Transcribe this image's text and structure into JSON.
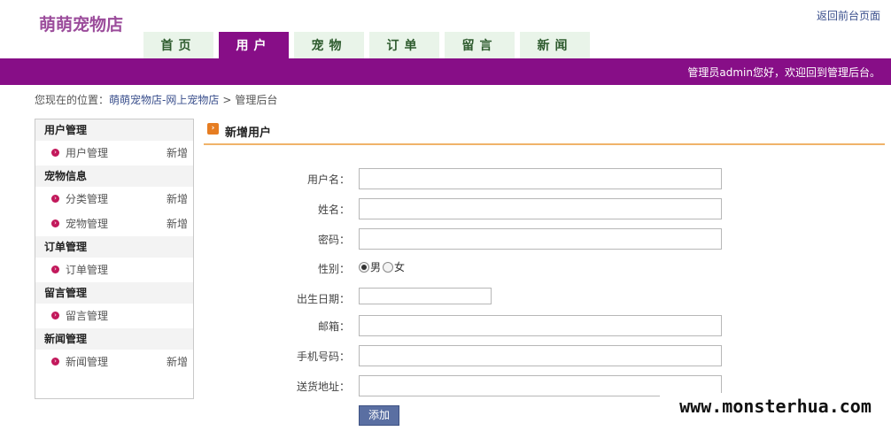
{
  "site": {
    "logo": "萌萌宠物店",
    "front_link": "返回前台页面"
  },
  "nav": {
    "tabs": [
      "首页",
      "用户",
      "宠物",
      "订单",
      "留言",
      "新闻"
    ],
    "active_index": 1
  },
  "topbar": {
    "welcome": "管理员admin您好，欢迎回到管理后台。",
    "color": "#870e87"
  },
  "breadcrumb": {
    "prefix": "您现在的位置：",
    "home": "萌萌宠物店-网上宠物店",
    "sep": ">",
    "current": "管理后台"
  },
  "sidebar": {
    "groups": [
      {
        "title": "用户管理",
        "items": [
          {
            "label": "用户管理",
            "add": "新增"
          }
        ]
      },
      {
        "title": "宠物信息",
        "items": [
          {
            "label": "分类管理",
            "add": "新增"
          },
          {
            "label": "宠物管理",
            "add": "新增"
          }
        ]
      },
      {
        "title": "订单管理",
        "items": [
          {
            "label": "订单管理",
            "add": ""
          }
        ]
      },
      {
        "title": "留言管理",
        "items": [
          {
            "label": "留言管理",
            "add": ""
          }
        ]
      },
      {
        "title": "新闻管理",
        "items": [
          {
            "label": "新闻管理",
            "add": "新增"
          }
        ]
      }
    ]
  },
  "panel": {
    "title": "新增用户"
  },
  "form": {
    "username": {
      "label": "用户名：",
      "value": ""
    },
    "name": {
      "label": "姓名：",
      "value": ""
    },
    "password": {
      "label": "密码：",
      "value": ""
    },
    "gender": {
      "label": "性别：",
      "options": [
        "男",
        "女"
      ],
      "selected": "男"
    },
    "birthday": {
      "label": "出生日期：",
      "value": ""
    },
    "email": {
      "label": "邮箱：",
      "value": ""
    },
    "phone": {
      "label": "手机号码：",
      "value": ""
    },
    "address": {
      "label": "送货地址：",
      "value": ""
    },
    "submit": "添加"
  },
  "watermark": "www.monsterhua.com"
}
